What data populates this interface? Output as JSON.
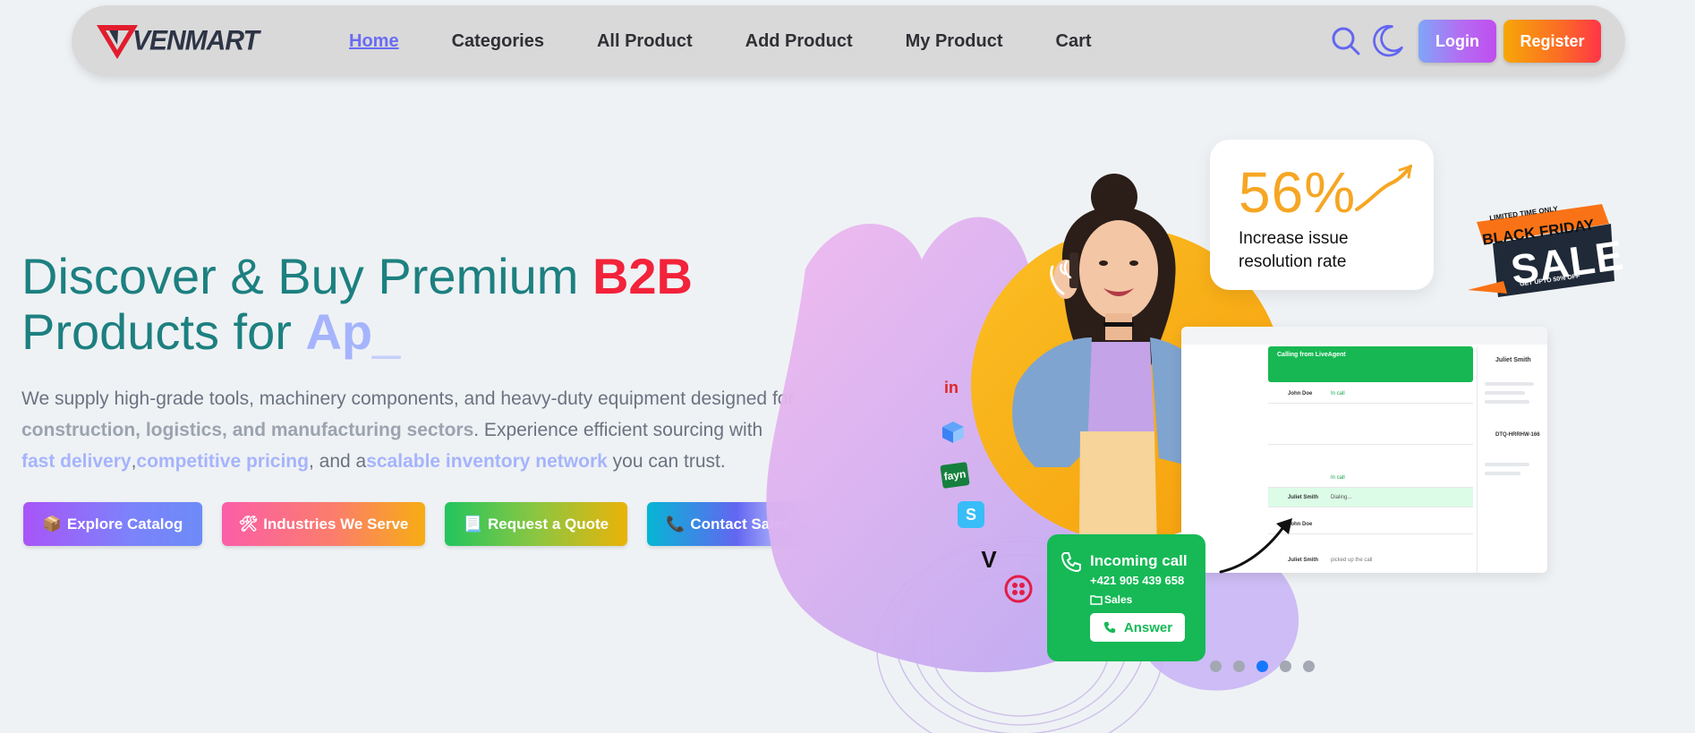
{
  "brand": {
    "name": "VENMART"
  },
  "nav": {
    "links": [
      "Home",
      "Categories",
      "All Product",
      "Add Product",
      "My Product",
      "Cart"
    ],
    "active": "Home",
    "login": "Login",
    "register": "Register"
  },
  "hero": {
    "title_part1": "Discover & Buy Premium ",
    "title_highlight": "B2B",
    "title_part2": "Products for ",
    "typed_text": "Ap",
    "typed_cursor": "_",
    "desc_1": "We supply high-grade tools, machinery components, and heavy-duty equipment designed for",
    "desc_strong": "construction, logistics, and manufacturing sectors",
    "desc_2": ". Experience efficient sourcing with",
    "hl_1": "fast delivery",
    "sep_1": ",",
    "hl_2": "competitive pricing",
    "sep_2": ", and a",
    "hl_3": "scalable inventory network",
    "desc_3": " you can trust.",
    "buttons": [
      {
        "icon": "📦",
        "label": "Explore Catalog"
      },
      {
        "icon": "🛠",
        "label": "Industries We Serve"
      },
      {
        "icon": "📃",
        "label": "Request a Quote"
      },
      {
        "icon": "📞",
        "label": "Contact Sales"
      }
    ]
  },
  "art": {
    "stat_value": "56%",
    "stat_caption_1": "Increase issue",
    "stat_caption_2": "resolution rate",
    "call_title": "Incoming call",
    "call_number": "+421 905 439 658",
    "call_dept": "Sales",
    "call_answer": "Answer",
    "dash_header": "Calling from LiveAgent",
    "dash_rows": [
      {
        "name": "John Doe",
        "status": "In call"
      },
      {
        "name": "John Doe",
        "status": "In call"
      },
      {
        "name": "Juliet Smith",
        "status": "Dialing..."
      },
      {
        "name": "John Doe",
        "status": ""
      },
      {
        "name": "Juliet Smith",
        "status": "picked up the call"
      }
    ],
    "side_name": "Juliet Smith",
    "side_ticket": "DTQ-HRRHW-166",
    "sale_top": "LIMITED TIME ONLY",
    "sale_mid": "BLACK FRIDAY",
    "sale_big": "SALE",
    "sale_bottom": "GET UPTO 50% OFF"
  },
  "carousel": {
    "count": 5,
    "active_index": 2
  },
  "colors": {
    "title": "#1d8080",
    "b2b": "#f2233a",
    "accent": "#a5b4fc",
    "nav_active": "#6a6cf2",
    "call_green": "#16b956",
    "stat_orange": "#f6a623"
  }
}
